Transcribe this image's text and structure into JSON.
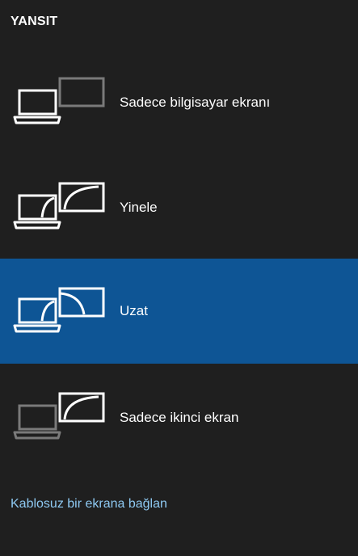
{
  "header": {
    "title": "YANSIT"
  },
  "options": [
    {
      "label": "Sadece bilgisayar ekranı",
      "icon": "pc-screen-only-icon",
      "selected": false
    },
    {
      "label": "Yinele",
      "icon": "duplicate-icon",
      "selected": false
    },
    {
      "label": "Uzat",
      "icon": "extend-icon",
      "selected": true
    },
    {
      "label": "Sadece ikinci ekran",
      "icon": "second-screen-only-icon",
      "selected": false
    }
  ],
  "footer": {
    "link_label": "Kablosuz bir ekrana bağlan"
  },
  "colors": {
    "background": "#1f1f1f",
    "selected": "#0e5595",
    "link": "#8ec9f2",
    "dim_icon": "#7a7a7a"
  }
}
